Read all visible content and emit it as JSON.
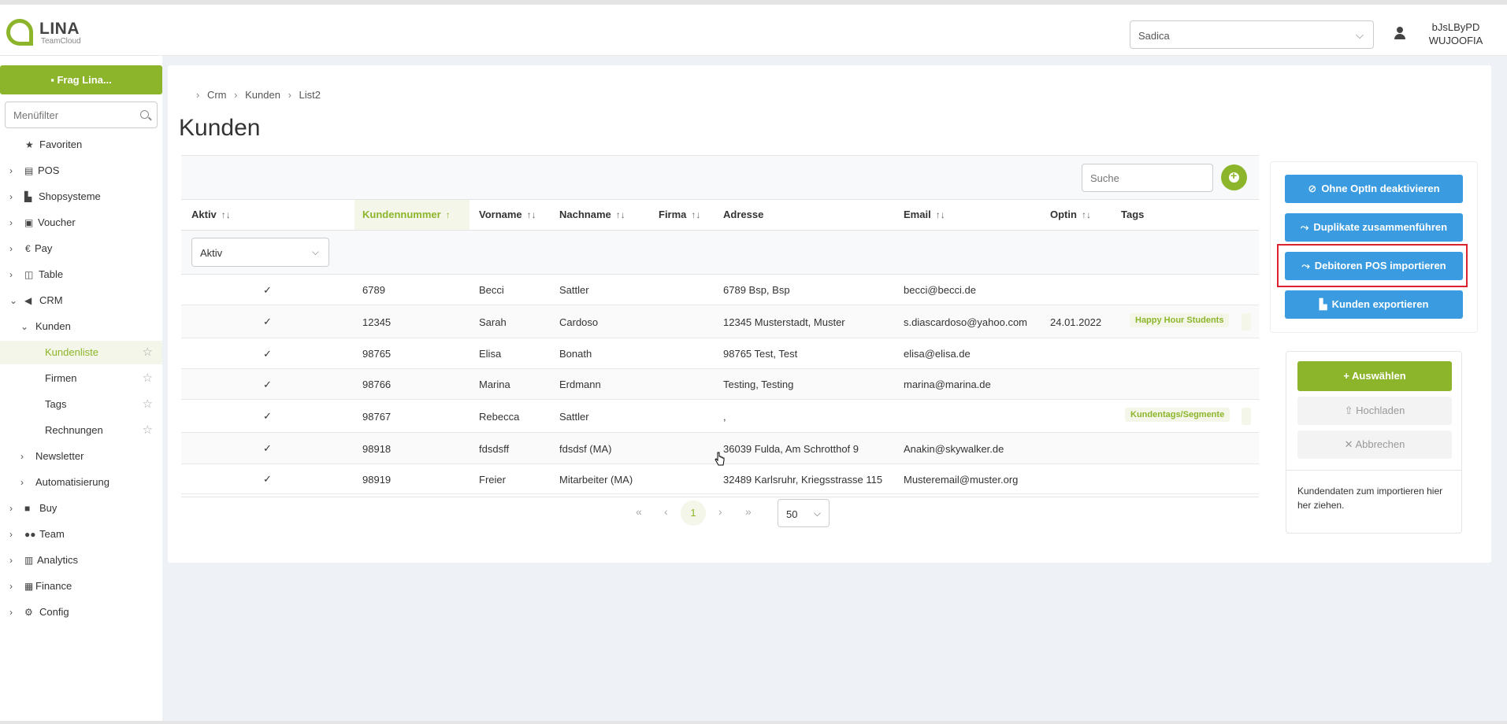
{
  "header": {
    "logo_name": "LINA",
    "logo_sub": "TeamCloud",
    "company_select": "Sadica",
    "user_name_line1": "bJsLByPD",
    "user_name_line2": "WUJOOFIA"
  },
  "sidebar": {
    "ask_button": "Frag Lina...",
    "menu_filter_placeholder": "Menüfilter",
    "items": [
      {
        "label": "Favoriten"
      },
      {
        "label": "POS"
      },
      {
        "label": "Shopsysteme"
      },
      {
        "label": "Voucher"
      },
      {
        "label": "Pay"
      },
      {
        "label": "Table"
      },
      {
        "label": "CRM"
      },
      {
        "label": "Kunden"
      },
      {
        "label": "Kundenliste"
      },
      {
        "label": "Firmen"
      },
      {
        "label": "Tags"
      },
      {
        "label": "Rechnungen"
      },
      {
        "label": "Newsletter"
      },
      {
        "label": "Automatisierung"
      },
      {
        "label": "Buy"
      },
      {
        "label": "Team"
      },
      {
        "label": "Analytics"
      },
      {
        "label": "Finance"
      },
      {
        "label": "Config"
      }
    ]
  },
  "breadcrumb": [
    "Crm",
    "Kunden",
    "List2"
  ],
  "page_title": "Kunden",
  "table": {
    "search_placeholder": "Suche",
    "columns": [
      "Aktiv",
      "Kundennummer",
      "Vorname",
      "Nachname",
      "Firma",
      "Adresse",
      "Email",
      "Optin",
      "Tags"
    ],
    "aktiv_filter": "Aktiv",
    "rows": [
      {
        "aktiv": "✓",
        "nr": "6789",
        "vorname": "Becci",
        "nachname": "Sattler",
        "firma": "",
        "adresse": "6789 Bsp, Bsp",
        "email": "becci@becci.de",
        "optin": "",
        "tag": ""
      },
      {
        "aktiv": "✓",
        "nr": "12345",
        "vorname": "Sarah",
        "nachname": "Cardoso",
        "firma": "",
        "adresse": "12345 Musterstadt, Muster",
        "email": "s.diascardoso@yahoo.com",
        "optin": "24.01.2022",
        "tag": "Happy Hour Students"
      },
      {
        "aktiv": "✓",
        "nr": "98765",
        "vorname": "Elisa",
        "nachname": "Bonath",
        "firma": "",
        "adresse": "98765 Test, Test",
        "email": "elisa@elisa.de",
        "optin": "",
        "tag": ""
      },
      {
        "aktiv": "✓",
        "nr": "98766",
        "vorname": "Marina",
        "nachname": "Erdmann",
        "firma": "",
        "adresse": "Testing, Testing",
        "email": "marina@marina.de",
        "optin": "",
        "tag": ""
      },
      {
        "aktiv": "✓",
        "nr": "98767",
        "vorname": "Rebecca",
        "nachname": "Sattler",
        "firma": "",
        "adresse": ",",
        "email": "",
        "optin": "",
        "tag": "Kundentags/Segmente"
      },
      {
        "aktiv": "✓",
        "nr": "98918",
        "vorname": "fdsdsff",
        "nachname": "fdsdsf (MA)",
        "firma": "",
        "adresse": "36039 Fulda, Am Schrotthof 9",
        "email": "Anakin@skywalker.de",
        "optin": "",
        "tag": ""
      },
      {
        "aktiv": "✓",
        "nr": "98919",
        "vorname": "Freier",
        "nachname": "Mitarbeiter (MA)",
        "firma": "",
        "adresse": "32489 Karlsruhr, Kriegsstrasse 115",
        "email": "Musteremail@muster.org",
        "optin": "",
        "tag": ""
      }
    ],
    "pagination": {
      "first": "«",
      "prev": "‹",
      "current": "1",
      "next": "›",
      "last": "»",
      "per_page": "50"
    }
  },
  "actions": {
    "deactivate": "Ohne OptIn deaktivieren",
    "merge": "Duplikate zusammenführen",
    "import_pos": "Debitoren POS importieren",
    "export": "Kunden exportieren"
  },
  "import": {
    "select": "Auswählen",
    "upload": "Hochladen",
    "cancel": "Abbrechen",
    "drop_hint": "Kundendaten zum importieren hier her ziehen."
  },
  "colors": {
    "brand_green": "#8db52b",
    "action_blue": "#3a9be0",
    "highlight_red": "#d9232e"
  }
}
